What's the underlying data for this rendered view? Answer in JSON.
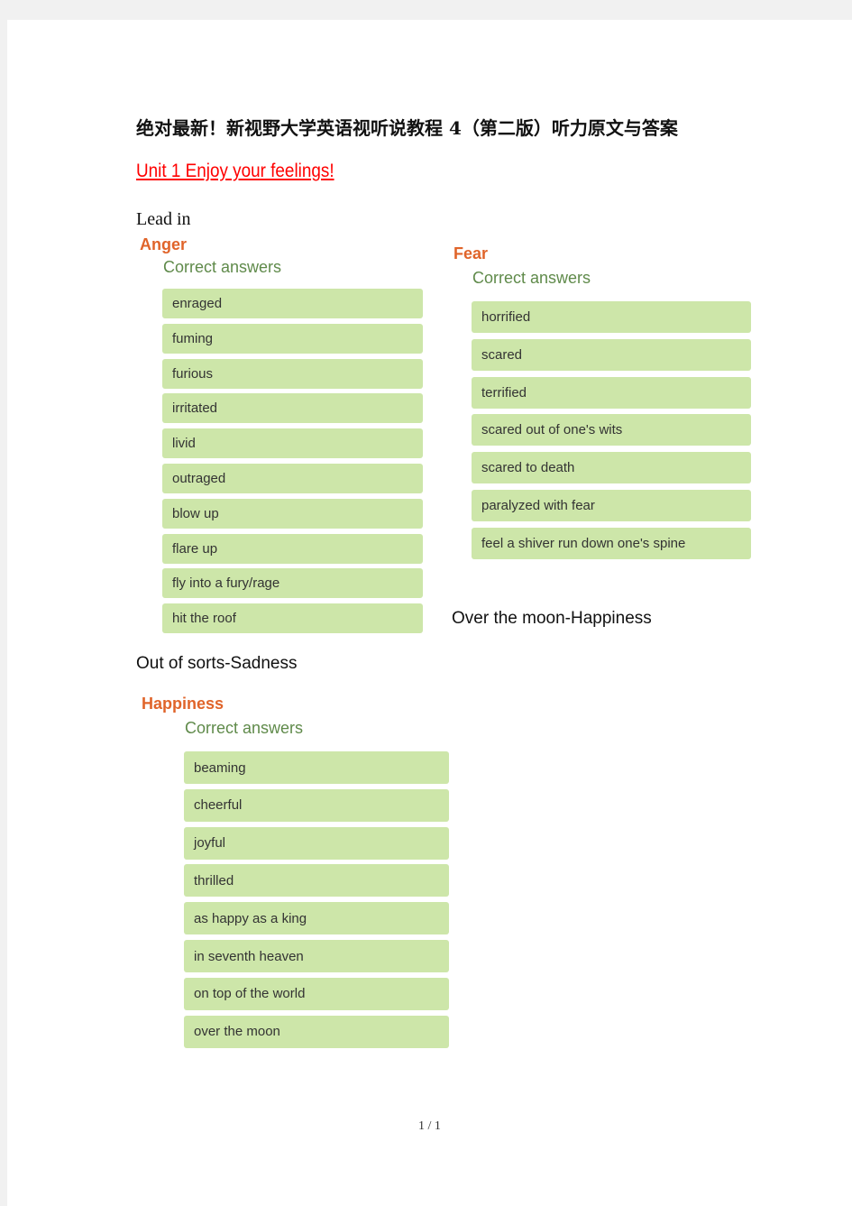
{
  "title": "绝对最新！新视野大学英语视听说教程 4（第二版）听力原文与答案",
  "unit_heading": "Unit 1    Enjoy  your  feelings! ",
  "lead_in": "Lead  in",
  "anger": {
    "heading": "Anger",
    "subheading": "Correct answers",
    "answers": [
      "enraged",
      "fuming",
      "furious",
      "irritated",
      "livid",
      "outraged",
      "blow up",
      "flare up",
      "fly into a fury/rage",
      "hit the roof"
    ]
  },
  "fear": {
    "heading": "Fear",
    "subheading": "Correct answers",
    "answers": [
      "horrified",
      "scared",
      "terrified",
      "scared out of one's wits",
      "scared to death",
      "paralyzed with fear",
      "feel a shiver run down one's spine"
    ]
  },
  "over_the_moon": "Over  the  moon-Happiness",
  "out_of_sorts": "Out  of  sorts-Sadness",
  "happiness": {
    "heading": "Happiness",
    "subheading": "Correct answers",
    "answers": [
      "beaming",
      "cheerful",
      "joyful",
      "thrilled",
      "as happy as a king",
      "in seventh heaven",
      "on top of the world",
      "over the moon"
    ]
  },
  "page_number": "1 / 1",
  "colors": {
    "answer_bg": "#cde6a9",
    "heading": "#e0642a",
    "subheading": "#5f8a4a",
    "unit": "#ff0000"
  }
}
